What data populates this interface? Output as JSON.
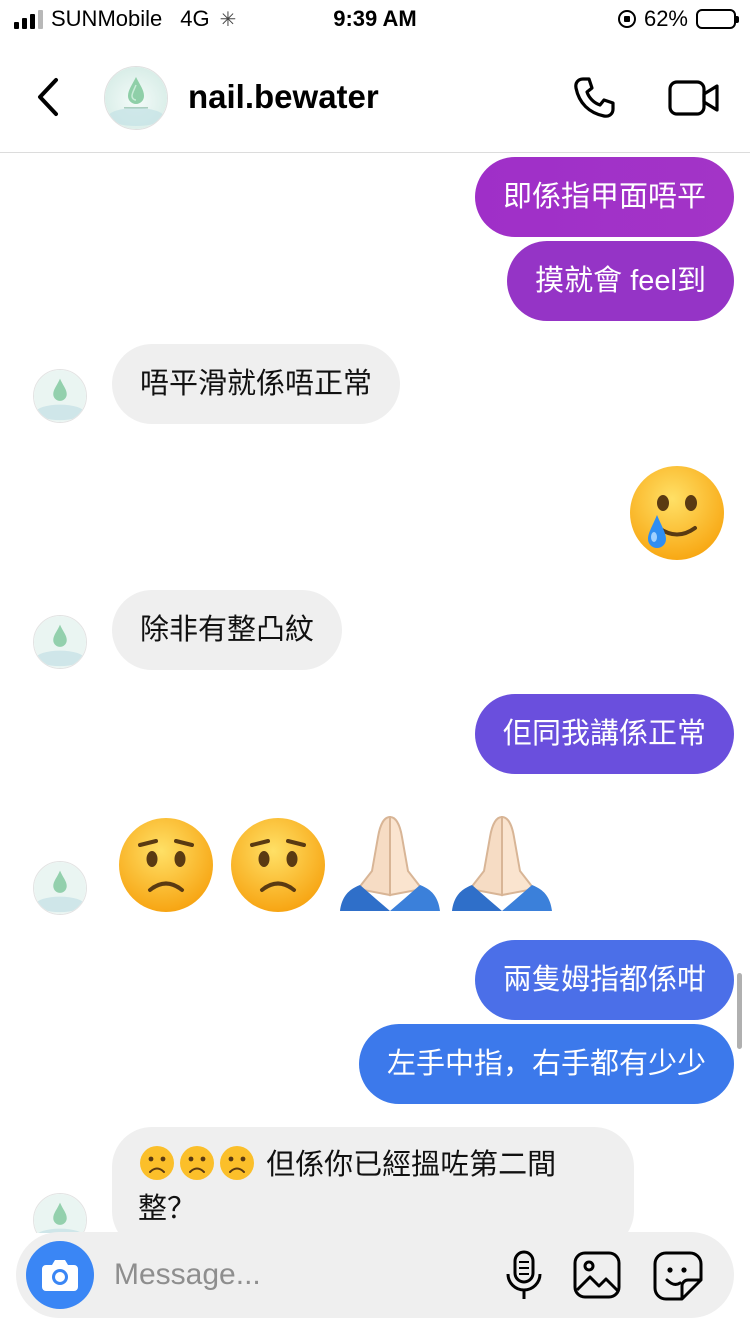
{
  "status_bar": {
    "carrier": "SUNMobile",
    "network": "4G",
    "time": "9:39 AM",
    "battery_percent": "62%",
    "battery_level": 0.62
  },
  "header": {
    "username": "nail.bewater",
    "avatar_caption": "Nail Be Water",
    "back_icon": "chevron-left-icon",
    "call_icon": "phone-icon",
    "video_icon": "video-camera-icon"
  },
  "messages": [
    {
      "direction": "out",
      "text": "即係指甲面唔平",
      "color": "#9a31c8"
    },
    {
      "direction": "out",
      "text": "摸就會 feel到",
      "color": "#9234c6"
    },
    {
      "direction": "in",
      "text": "唔平滑就係唔正常"
    },
    {
      "direction": "out",
      "emoji": "face-holding-back-tears"
    },
    {
      "direction": "in",
      "text": "除非有整凸紋"
    },
    {
      "direction": "out",
      "text": "佢同我講係正常",
      "color": "#6a4ede"
    },
    {
      "direction": "in",
      "emoji": "worried-face worried-face folded-hands folded-hands"
    },
    {
      "direction": "out",
      "text": "兩隻姆指都係咁",
      "color": "#4a70e8"
    },
    {
      "direction": "out",
      "text": "左手中指，右手都有少少",
      "color": "#3b78ea"
    },
    {
      "direction": "in",
      "text": "但係你已經搵咗第二間",
      "text_line2": "整？",
      "emoji": "frowning-face x3"
    }
  ],
  "composer": {
    "placeholder": "Message...",
    "camera_icon": "camera-icon",
    "mic_icon": "microphone-icon",
    "gallery_icon": "image-icon",
    "sticker_icon": "sticker-icon"
  }
}
